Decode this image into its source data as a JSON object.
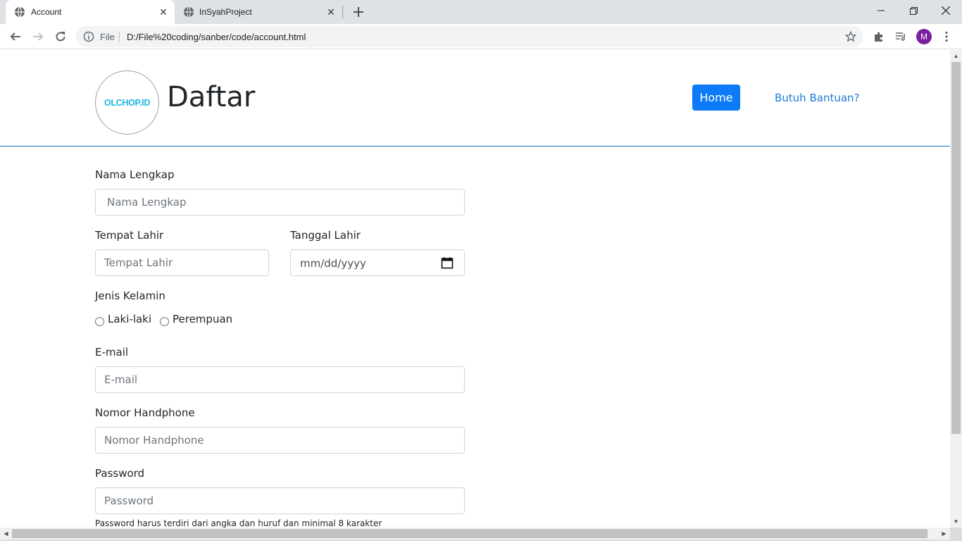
{
  "browser": {
    "tabs": [
      {
        "title": "Account",
        "active": true
      },
      {
        "title": "InSyahProject",
        "active": false
      }
    ],
    "address": {
      "scheme_label": "File",
      "url": "D:/File%20coding/sanber/code/account.html"
    },
    "profile_initial": "M"
  },
  "header": {
    "logo_text": "OLCHOP.ID",
    "title": "Daftar",
    "home_label": "Home",
    "help_label": "Butuh Bantuan?"
  },
  "form": {
    "full_name": {
      "label": "Nama Lengkap",
      "placeholder": "Nama Lengkap"
    },
    "birth_place": {
      "label": "Tempat Lahir",
      "placeholder": "Tempat Lahir"
    },
    "birth_date": {
      "label": "Tanggal Lahir",
      "placeholder": "mm/dd/yyyy"
    },
    "gender": {
      "label": "Jenis Kelamin",
      "options": [
        "Laki-laki",
        "Perempuan"
      ]
    },
    "email": {
      "label": "E-mail",
      "placeholder": "E-mail"
    },
    "phone": {
      "label": "Nomor Handphone",
      "placeholder": "Nomor Handphone"
    },
    "password": {
      "label": "Password",
      "placeholder": "Password",
      "help": "Password harus terdiri dari angka dan huruf dan minimal 8 karakter"
    }
  },
  "colors": {
    "primary": "#0d7bf7",
    "link": "#1f7ad6",
    "logo": "#1eb7e6",
    "header_border": "#1f6fb2",
    "avatar": "#7b1fa2"
  }
}
